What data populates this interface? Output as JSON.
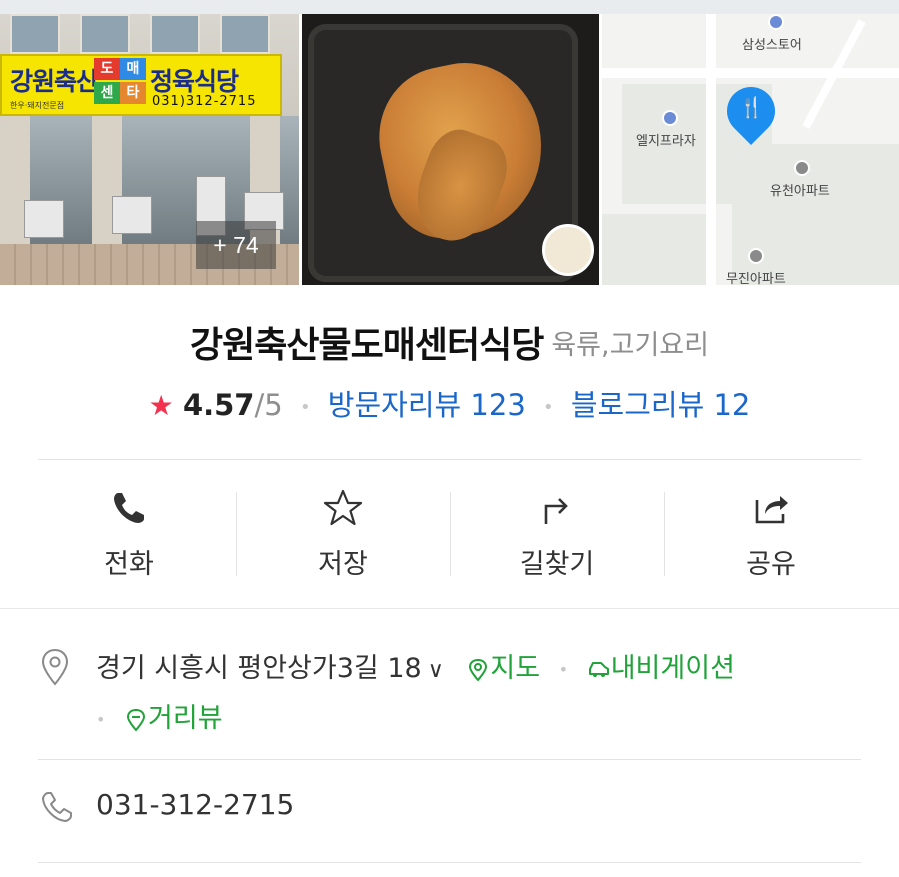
{
  "photos": {
    "more_count": "+ 74",
    "storefront_sign": {
      "name_part1": "강원축산",
      "box1": "도",
      "box2": "매",
      "box3": "센",
      "box4": "타",
      "name_part2": "정육식당",
      "phone": "031)312-2715",
      "sub": "한우·돼지전문점"
    },
    "map_pois": [
      "삼성스토어",
      "엘지프라자",
      "유천아파트",
      "무진아파트"
    ]
  },
  "place": {
    "name": "강원축산물도매센터식당",
    "category": "육류,고기요리",
    "rating": "4.57",
    "rating_outof": "/5",
    "visitor_reviews": "방문자리뷰 123",
    "blog_reviews": "블로그리뷰 12"
  },
  "actions": [
    {
      "label": "전화",
      "icon": "phone-icon"
    },
    {
      "label": "저장",
      "icon": "star-outline-icon"
    },
    {
      "label": "길찾기",
      "icon": "directions-icon"
    },
    {
      "label": "공유",
      "icon": "share-icon"
    }
  ],
  "address": {
    "text": "경기 시흥시 평안상가3길 18",
    "map_link": "지도",
    "navigation_link": "내비게이션",
    "street_view_link": "거리뷰"
  },
  "phone": {
    "number": "031-312-2715"
  },
  "colors": {
    "accent_blue": "#1a67c9",
    "accent_green": "#21a33a",
    "star_red": "#f2324f",
    "pin_blue": "#1b8ef0"
  }
}
